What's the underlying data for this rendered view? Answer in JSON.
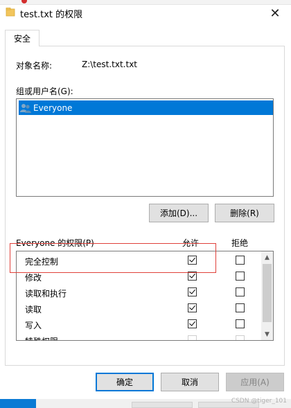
{
  "window": {
    "title": "test.txt 的权限",
    "close_glyph": "✕"
  },
  "tabs": [
    {
      "label": "安全"
    }
  ],
  "object": {
    "label": "对象名称:",
    "value": "Z:\\test.txt.txt"
  },
  "groups": {
    "label": "组或用户名(G):",
    "items": [
      {
        "name": "Everyone",
        "selected": true,
        "icon": "users-icon"
      }
    ]
  },
  "buttons": {
    "add": "添加(D)...",
    "remove": "删除(R)",
    "ok": "确定",
    "cancel": "取消",
    "apply": "应用(A)"
  },
  "permissions": {
    "header": "Everyone 的权限(P)",
    "allow_header": "允许",
    "deny_header": "拒绝",
    "rows": [
      {
        "name": "完全控制",
        "allow": true,
        "deny": false
      },
      {
        "name": "修改",
        "allow": true,
        "deny": false
      },
      {
        "name": "读取和执行",
        "allow": true,
        "deny": false
      },
      {
        "name": "读取",
        "allow": true,
        "deny": false
      },
      {
        "name": "写入",
        "allow": true,
        "deny": false
      },
      {
        "name": "特殊权限",
        "allow": false,
        "deny": false
      }
    ]
  },
  "watermark": "CSDN @tiger_101",
  "colors": {
    "selection": "#0078d7",
    "highlight_box": "#e0403a"
  }
}
